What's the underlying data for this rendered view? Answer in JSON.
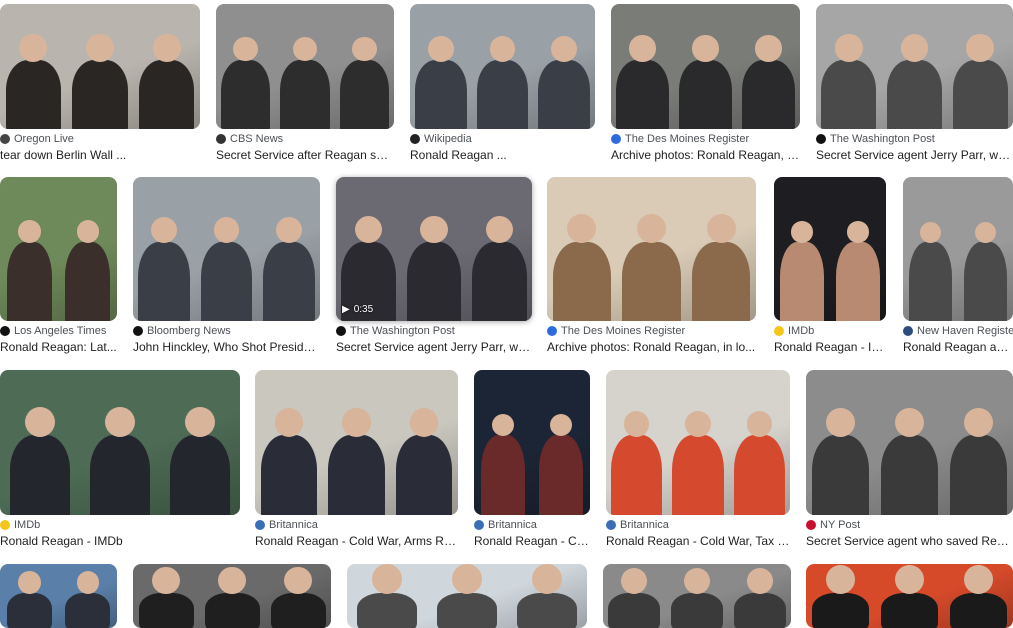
{
  "results": [
    {
      "source": "Oregon Live",
      "title": "tear down Berlin Wall ...",
      "fav": "#444444",
      "bg": "#b9b4ad",
      "fg": "#2a2623"
    },
    {
      "source": "CBS News",
      "title": "Secret Service after Reagan sho...",
      "fav": "#333333",
      "bg": "#8f8f8f",
      "fg": "#2d2d2d"
    },
    {
      "source": "Wikipedia",
      "title": "Ronald Reagan ...",
      "fav": "#222222",
      "bg": "#9aa1a6",
      "fg": "#3a3f47"
    },
    {
      "source": "The Des Moines Register",
      "title": "Archive photos: Ronald Reagan, in...",
      "fav": "#2d6cdf",
      "bg": "#7a7c78",
      "fg": "#2a2a2c"
    },
    {
      "source": "The Washington Post",
      "title": "Secret Service agent Jerry Parr, who ...",
      "fav": "#111111",
      "bg": "#a6a6a6",
      "fg": "#4a4a4a"
    },
    {
      "source": "Los Angeles Times",
      "title": "Ronald Reagan: Lat...",
      "fav": "#111111",
      "bg": "#6f8a5a",
      "fg": "#3a2f2b"
    },
    {
      "source": "Bloomberg News",
      "title": "John Hinckley, Who Shot Preside...",
      "fav": "#111111",
      "bg": "#9aa1a6",
      "fg": "#3a3f47"
    },
    {
      "source": "The Washington Post",
      "title": "Secret Service agent Jerry Parr, wh...",
      "fav": "#111111",
      "bg": "#6b6a73",
      "fg": "#2a2a30",
      "duration": "0:35"
    },
    {
      "source": "The Des Moines Register",
      "title": "Archive photos: Ronald Reagan, in lo...",
      "fav": "#2d6cdf",
      "bg": "#d9cbb6",
      "fg": "#8a6a4a"
    },
    {
      "source": "IMDb",
      "title": "Ronald Reagan - IM...",
      "fav": "#f5c518",
      "bg": "#1e1e22",
      "fg": "#b98a72"
    },
    {
      "source": "New Haven Register",
      "title": "Ronald Reagan ass...",
      "fav": "#2b4c7e",
      "bg": "#9a9a9a",
      "fg": "#4a4a4a"
    },
    {
      "source": "IMDb",
      "title": "Ronald Reagan - IMDb",
      "fav": "#f5c518",
      "bg": "#4d6b55",
      "fg": "#24262e"
    },
    {
      "source": "Britannica",
      "title": "Ronald Reagan - Cold War, Arms Rac...",
      "fav": "#3a6fb5",
      "bg": "#c9c7be",
      "fg": "#2a2c38"
    },
    {
      "source": "Britannica",
      "title": "Ronald Reagan - Co...",
      "fav": "#3a6fb5",
      "bg": "#1c2535",
      "fg": "#6a2a2a"
    },
    {
      "source": "Britannica",
      "title": "Ronald Reagan - Cold War, Tax C...",
      "fav": "#3a6fb5",
      "bg": "#d6d3cd",
      "fg": "#d54a2e"
    },
    {
      "source": "NY Post",
      "title": "Secret Service agent who saved Reaga...",
      "fav": "#c8102e",
      "bg": "#8c8c8c",
      "fg": "#3a3a3a"
    },
    {
      "source": "",
      "title": "",
      "fav": "",
      "bg": "#5a7fa8",
      "fg": "#2a2f3a"
    },
    {
      "source": "",
      "title": "",
      "fav": "",
      "bg": "#6a6a6a",
      "fg": "#1f1f1f"
    },
    {
      "source": "",
      "title": "",
      "fav": "",
      "bg": "#cfd6dc",
      "fg": "#4a4a4a"
    },
    {
      "source": "",
      "title": "",
      "fav": "",
      "bg": "#8a8a8a",
      "fg": "#3a3a3a"
    },
    {
      "source": "",
      "title": "",
      "fav": "",
      "bg": "#d64a2a",
      "fg": "#1a1a1a"
    }
  ]
}
